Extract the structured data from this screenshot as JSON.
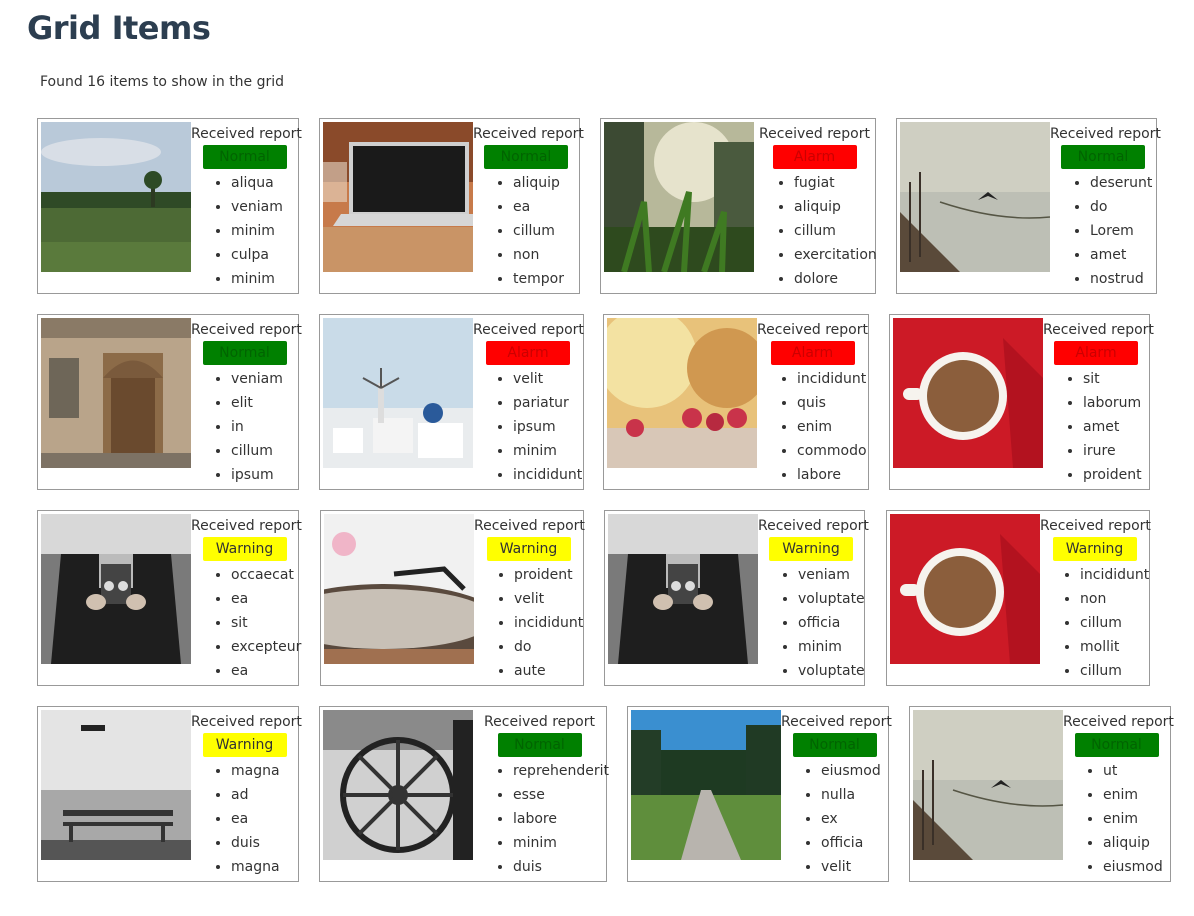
{
  "page": {
    "title": "Grid Items",
    "summary": "Found 16 items to show in the grid"
  },
  "colors": {
    "normal": "#008000",
    "alarm": "#ff0000",
    "warning": "#ffff00",
    "title": "#2c3e50"
  },
  "cards": [
    {
      "image": "meadow-photo",
      "report": "Received report",
      "status": "Normal",
      "status_type": "normal",
      "items": [
        "aliqua",
        "veniam",
        "minim",
        "culpa",
        "minim"
      ]
    },
    {
      "image": "laptop-photo",
      "report": "Received report",
      "status": "Normal",
      "status_type": "normal",
      "items": [
        "aliquip",
        "ea",
        "cillum",
        "non",
        "tempor"
      ]
    },
    {
      "image": "grass-photo",
      "report": "Received report",
      "status": "Alarm",
      "status_type": "alarm",
      "items": [
        "fugiat",
        "aliquip",
        "cillum",
        "exercitation",
        "dolore"
      ]
    },
    {
      "image": "lake-boat-photo",
      "report": "Received report",
      "status": "Normal",
      "status_type": "normal",
      "items": [
        "deserunt",
        "do",
        "Lorem",
        "amet",
        "nostrud"
      ]
    },
    {
      "image": "door-photo",
      "report": "Received report",
      "status": "Normal",
      "status_type": "normal",
      "items": [
        "veniam",
        "elit",
        "in",
        "cillum",
        "ipsum"
      ]
    },
    {
      "image": "santorini-photo",
      "report": "Received report",
      "status": "Alarm",
      "status_type": "alarm",
      "items": [
        "velit",
        "pariatur",
        "ipsum",
        "minim",
        "incididunt"
      ]
    },
    {
      "image": "raspberries-photo",
      "report": "Received report",
      "status": "Alarm",
      "status_type": "alarm",
      "items": [
        "incididunt",
        "quis",
        "enim",
        "commodo",
        "labore"
      ]
    },
    {
      "image": "coffee-photo",
      "report": "Received report",
      "status": "Alarm",
      "status_type": "alarm",
      "items": [
        "sit",
        "laborum",
        "amet",
        "irure",
        "proident"
      ]
    },
    {
      "image": "camera-photo",
      "report": "Received report",
      "status": "Warning",
      "status_type": "warning",
      "items": [
        "occaecat",
        "ea",
        "sit",
        "excepteur",
        "ea"
      ]
    },
    {
      "image": "turntable-photo",
      "report": "Received report",
      "status": "Warning",
      "status_type": "warning",
      "items": [
        "proident",
        "velit",
        "incididunt",
        "do",
        "aute"
      ]
    },
    {
      "image": "camera-photo",
      "report": "Received report",
      "status": "Warning",
      "status_type": "warning",
      "items": [
        "veniam",
        "voluptate",
        "officia",
        "minim",
        "voluptate"
      ]
    },
    {
      "image": "coffee-photo",
      "report": "Received report",
      "status": "Warning",
      "status_type": "warning",
      "items": [
        "incididunt",
        "non",
        "cillum",
        "mollit",
        "cillum"
      ]
    },
    {
      "image": "bench-photo",
      "report": "Received report",
      "status": "Warning",
      "status_type": "warning",
      "items": [
        "magna",
        "ad",
        "ea",
        "duis",
        "magna"
      ]
    },
    {
      "image": "wagon-wheel-photo",
      "report": "Received report",
      "status": "Normal",
      "status_type": "normal",
      "items": [
        "reprehenderit",
        "esse",
        "labore",
        "minim",
        "duis"
      ]
    },
    {
      "image": "path-photo",
      "report": "Received report",
      "status": "Normal",
      "status_type": "normal",
      "items": [
        "eiusmod",
        "nulla",
        "ex",
        "officia",
        "velit"
      ]
    },
    {
      "image": "lake-boat-photo",
      "report": "Received report",
      "status": "Normal",
      "status_type": "normal",
      "items": [
        "ut",
        "enim",
        "enim",
        "aliquip",
        "eiusmod"
      ]
    }
  ]
}
